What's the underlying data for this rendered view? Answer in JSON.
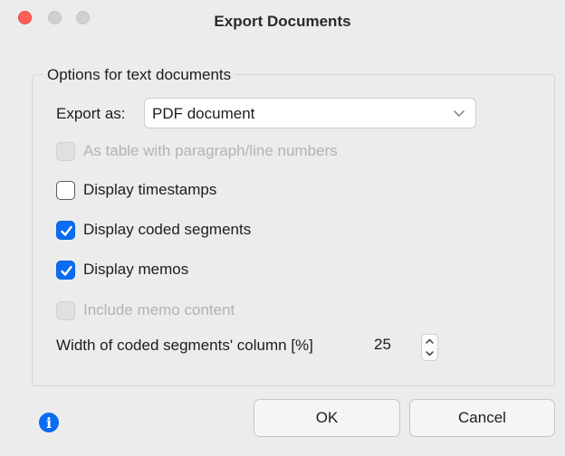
{
  "window": {
    "title": "Export Documents"
  },
  "options_group": {
    "title": "Options for text documents",
    "export_as_label": "Export as:",
    "export_as_value": "PDF document",
    "checkboxes": [
      {
        "label": "As table with paragraph/line numbers",
        "checked": false,
        "enabled": false
      },
      {
        "label": "Display timestamps",
        "checked": false,
        "enabled": true
      },
      {
        "label": "Display coded segments",
        "checked": true,
        "enabled": true
      },
      {
        "label": "Display memos",
        "checked": true,
        "enabled": true
      },
      {
        "label": "Include memo content",
        "checked": false,
        "enabled": false
      }
    ],
    "width_label": "Width of coded segments' column [%]",
    "width_value": "25"
  },
  "buttons": {
    "ok": "OK",
    "cancel": "Cancel"
  },
  "icons": {
    "info": "info-icon",
    "dropdown": "chevron-down-icon",
    "stepper": "up-down-stepper-icon"
  },
  "colors": {
    "accent": "#0a6cf0",
    "close": "#ff5f57",
    "disabled_text": "#b3b3b3"
  }
}
